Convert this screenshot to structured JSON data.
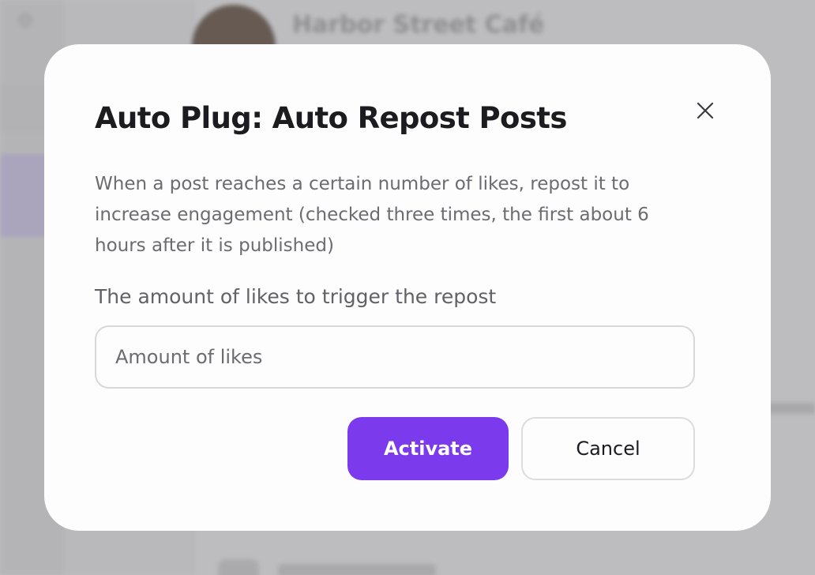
{
  "background": {
    "page_title": "Harbor Street Café"
  },
  "modal": {
    "title": "Auto Plug: Auto Repost Posts",
    "description": "When a post reaches a certain number of likes, repost it to increase engagement (checked three times, the first about 6 hours after it is published)",
    "field_label": "The amount of likes to trigger the repost",
    "input": {
      "value": "",
      "placeholder": "Amount of likes"
    },
    "activate_label": "Activate",
    "cancel_label": "Cancel",
    "close_icon": "close-icon"
  },
  "colors": {
    "accent": "#7c3aed",
    "overlay": "#bdbdc0",
    "modal_bg": "#fdfdfd",
    "title_text": "#1c1c20",
    "body_text": "#6b6b70"
  }
}
